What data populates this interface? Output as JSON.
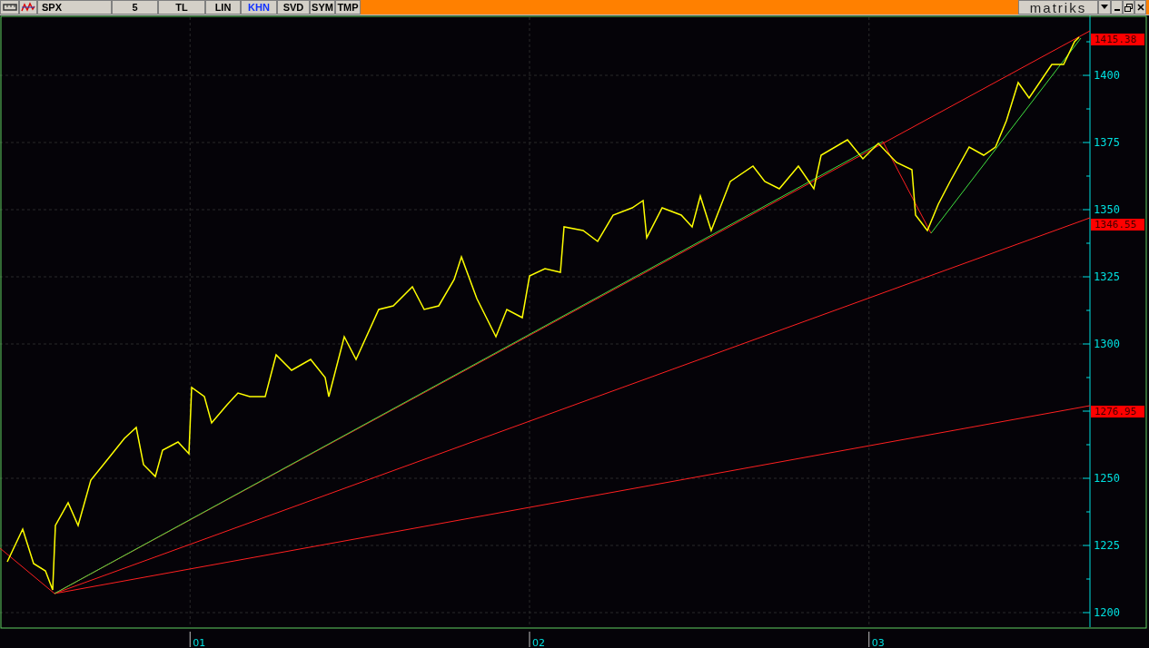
{
  "toolbar": {
    "symbol": "SPX",
    "buttons": [
      {
        "label": "5",
        "selected": false
      },
      {
        "label": "TL",
        "selected": false
      },
      {
        "label": "LIN",
        "selected": false
      },
      {
        "label": "KHN",
        "selected": true
      },
      {
        "label": "SVD",
        "selected": false
      },
      {
        "label": "SYM",
        "selected": false
      },
      {
        "label": "TMP",
        "selected": false
      }
    ],
    "logo": "matriks"
  },
  "chart": {
    "chart_data": {
      "type": "line",
      "ylim": [
        1195,
        1422
      ],
      "xlim": [
        0.416,
        3.79
      ],
      "grid": true,
      "yticks": [
        1200,
        1225,
        1250,
        1300,
        1325,
        1350,
        1375,
        1400
      ],
      "xticks": [
        {
          "value": 1,
          "label": "01"
        },
        {
          "value": 2,
          "label": "02"
        },
        {
          "value": 3,
          "label": "03"
        }
      ],
      "annotations": [
        "1415.38",
        "1346.55",
        "1276.95"
      ]
    }
  }
}
